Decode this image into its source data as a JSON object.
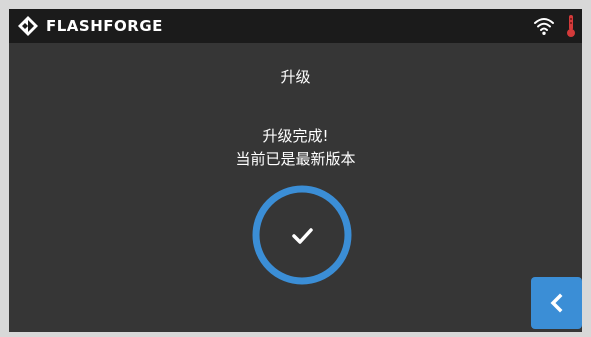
{
  "header": {
    "brand": "FLASHFORGE",
    "brand_icon": "flashforge-logo-icon",
    "wifi_icon": "wifi-icon",
    "temperature_icon": "thermometer-icon"
  },
  "page": {
    "title": "升级",
    "message_line1": "升级完成!",
    "message_line2": "当前已是最新版本",
    "status_icon": "checkmark-circle-icon"
  },
  "nav": {
    "back_icon": "chevron-left-icon"
  },
  "colors": {
    "background": "#363636",
    "topbar": "#1b1b1b",
    "accent": "#3b8ed6",
    "warning_red": "#d33a3a",
    "text": "#ffffff"
  }
}
